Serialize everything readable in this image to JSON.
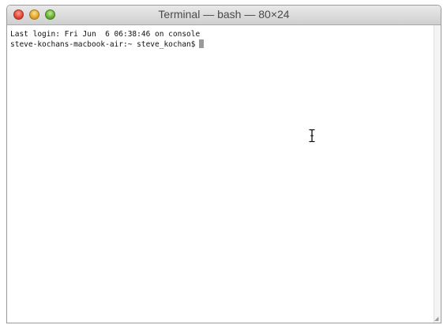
{
  "window": {
    "title": "Terminal — bash — 80×24"
  },
  "terminal": {
    "lines": [
      "Last login: Fri Jun  6 06:38:46 on console",
      "steve-kochans-macbook-air:~ steve_kochan$"
    ]
  },
  "icons": {
    "close": "close-button",
    "minimize": "minimize-button",
    "zoom": "zoom-button",
    "mouse_cursor": "ibeam-cursor-icon",
    "resize": "resize-grip-icon"
  },
  "colors": {
    "close": "#d8382b",
    "minimize": "#d99a1e",
    "zoom": "#5ea02a",
    "text": "#111111",
    "background": "#ffffff"
  }
}
